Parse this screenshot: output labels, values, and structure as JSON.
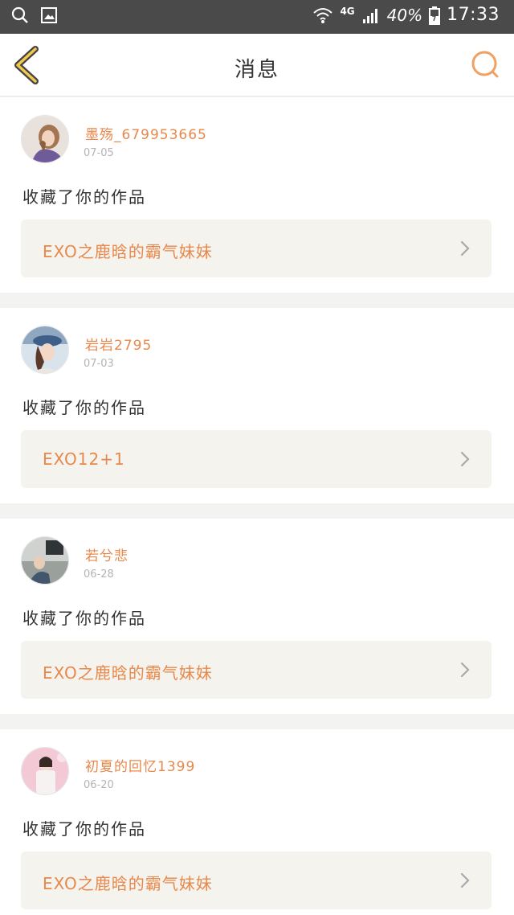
{
  "status_bar": {
    "network": "4G",
    "battery": "40%",
    "time": "17:33",
    "icons": [
      "search-icon",
      "image-icon",
      "wifi-icon",
      "signal-icon",
      "battery-icon"
    ]
  },
  "header": {
    "title": "消息",
    "back_icon": "chevron-left-icon",
    "search_icon": "search-icon",
    "accent": "#f0a060"
  },
  "colors": {
    "name": "#e8884b",
    "work_bg": "#f4f3ee",
    "divider": "#f3f3f1"
  },
  "messages": [
    {
      "username": "墨殇_679953665",
      "date": "07-05",
      "action": "收藏了你的作品",
      "work_title": "EXO之鹿晗的霸气妹妹"
    },
    {
      "username": "岩岩2795",
      "date": "07-03",
      "action": "收藏了你的作品",
      "work_title": "EXO12+1"
    },
    {
      "username": "若兮悲",
      "date": "06-28",
      "action": "收藏了你的作品",
      "work_title": "EXO之鹿晗的霸气妹妹"
    },
    {
      "username": "初夏的回忆1399",
      "date": "06-20",
      "action": "收藏了你的作品",
      "work_title": "EXO之鹿晗的霸气妹妹"
    }
  ]
}
